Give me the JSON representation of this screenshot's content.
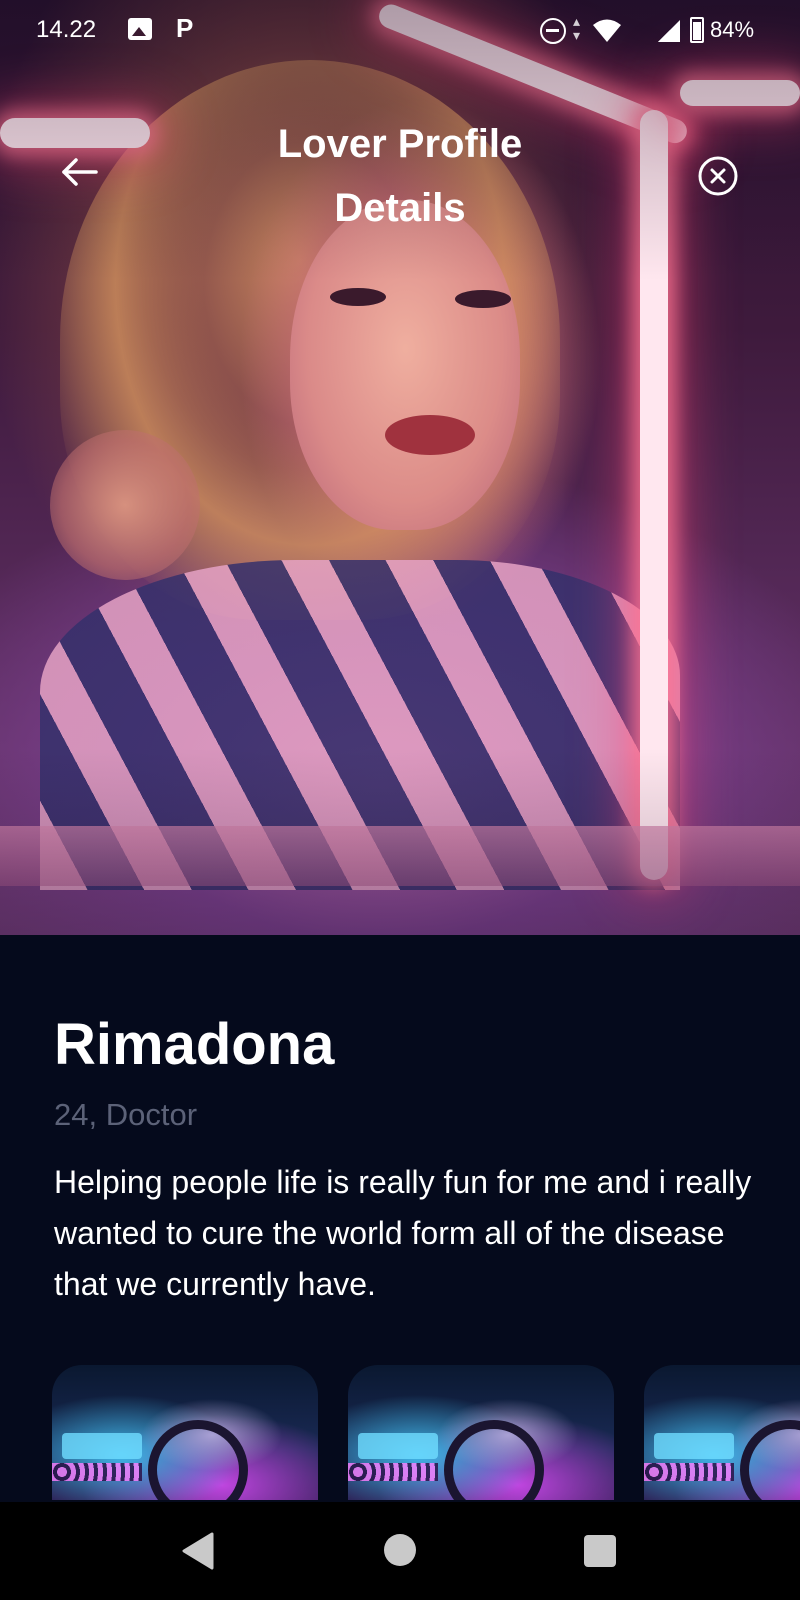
{
  "status_bar": {
    "time": "14.22",
    "battery": "84%",
    "icons": [
      "gallery-icon",
      "p-icon",
      "dnd-icon",
      "wifi-icon",
      "signal-icon",
      "battery-icon"
    ]
  },
  "header": {
    "title": "Lover Profile Details",
    "back_icon": "arrow-left-icon",
    "close_icon": "close-circle-icon"
  },
  "profile": {
    "name": "Rimadona",
    "subtitle": "24, Doctor",
    "bio": "Helping people life is really fun for me and i really wanted to cure the world form all of the disease that we currently have."
  },
  "gallery": {
    "items": [
      {
        "icon": "car-interior-image"
      },
      {
        "icon": "car-interior-image"
      },
      {
        "icon": "car-interior-image"
      }
    ]
  },
  "nav_bar": {
    "icons": [
      "nav-back-icon",
      "nav-home-icon",
      "nav-recents-icon"
    ]
  },
  "colors": {
    "background": "#050a1c",
    "subtitle": "#5c6278",
    "text": "#ffffff"
  }
}
